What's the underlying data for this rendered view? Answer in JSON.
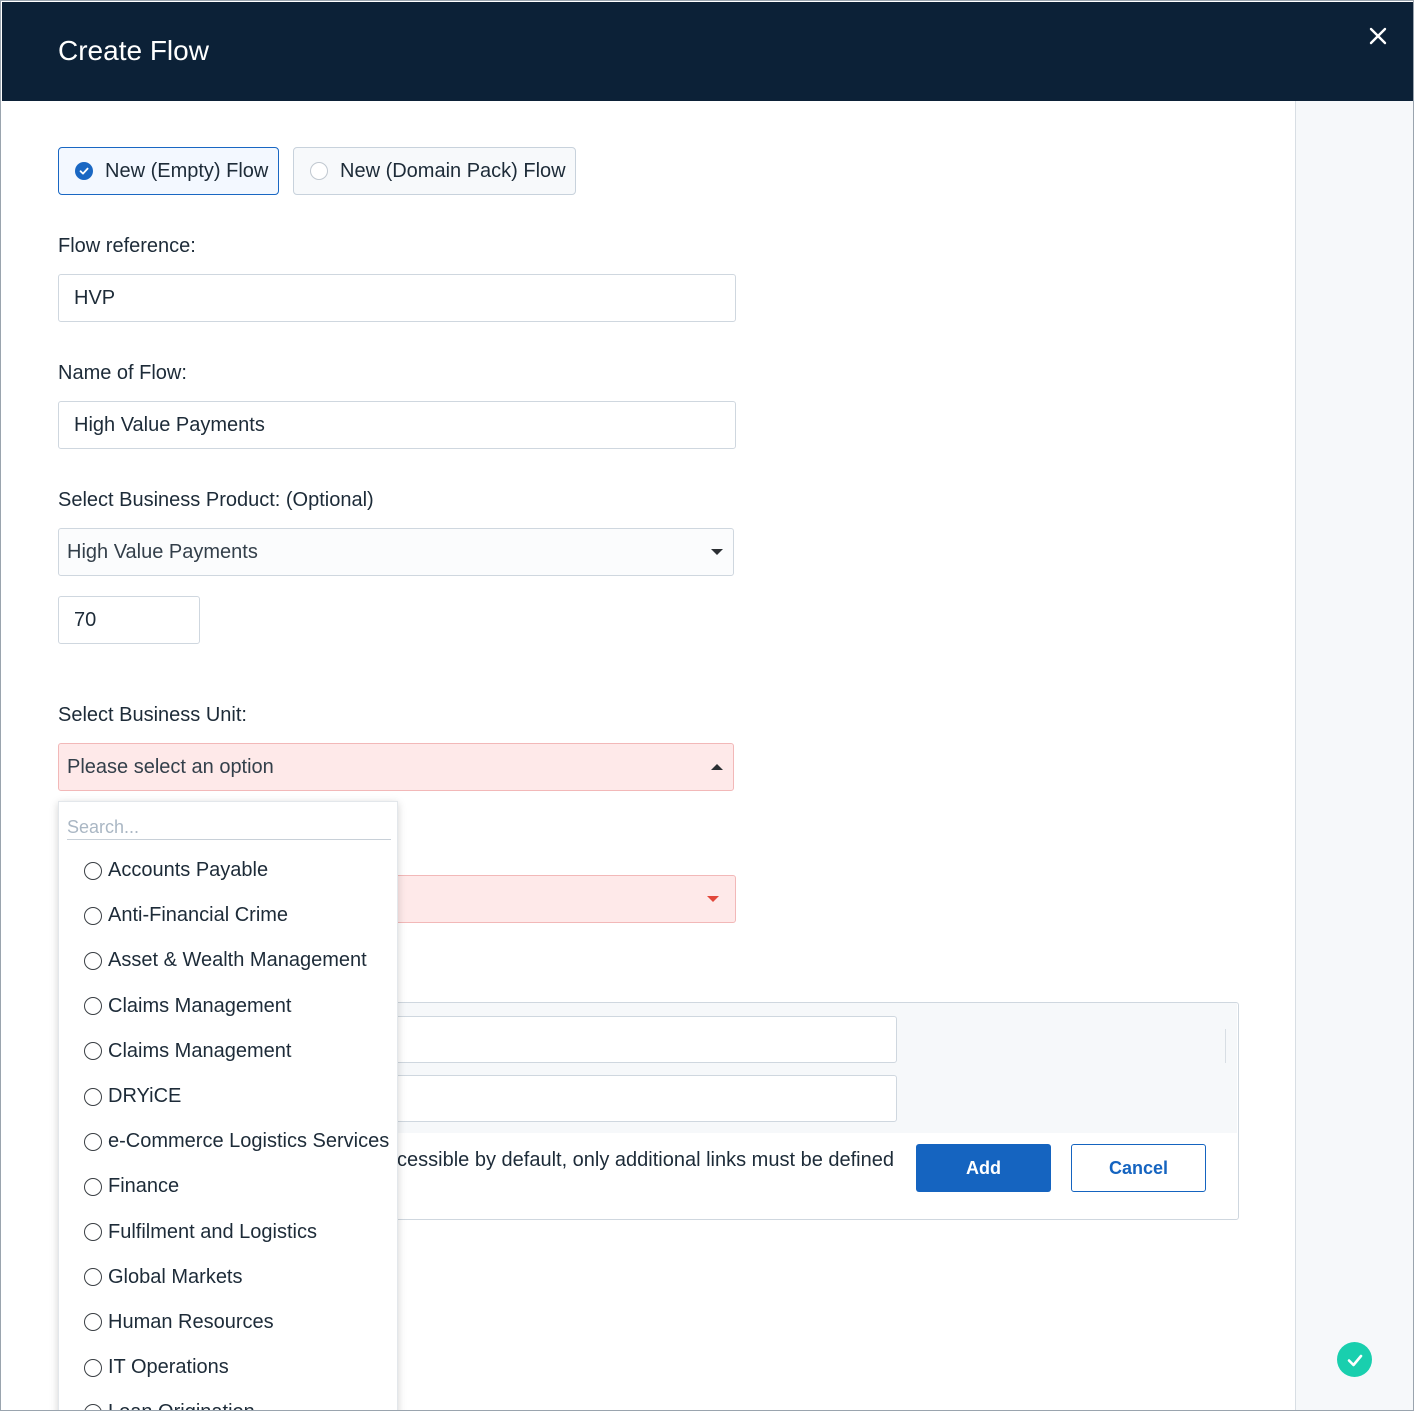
{
  "header": {
    "title": "Create Flow",
    "close_icon": "close-icon"
  },
  "flow_type": {
    "options": [
      {
        "label": "New (Empty) Flow",
        "selected": true
      },
      {
        "label": "New (Domain Pack) Flow",
        "selected": false
      }
    ]
  },
  "form": {
    "flow_reference": {
      "label": "Flow reference:",
      "value": "HVP"
    },
    "flow_name": {
      "label": "Name of Flow:",
      "value": "High Value Payments"
    },
    "business_product": {
      "label": "Select Business Product: (Optional)",
      "value": "High Value Payments",
      "extra_value": "70"
    },
    "business_unit": {
      "label": "Select Business Unit:",
      "placeholder": "Please select an option"
    }
  },
  "dropdown": {
    "search_placeholder": "Search...",
    "options": [
      "Accounts Payable",
      "Anti-Financial Crime",
      "Asset & Wealth Management",
      "Claims Management",
      "Claims Management",
      "DRYiCE",
      "e-Commerce Logistics Services",
      "Finance",
      "Fulfilment and Logistics",
      "Global Markets",
      "Human Resources",
      "IT Operations",
      "Loan Origination"
    ]
  },
  "links_panel": {
    "note": "ccessible by default, only additional links must be defined",
    "add_label": "Add",
    "cancel_label": "Cancel"
  },
  "colors": {
    "header_bg": "#0c2137",
    "primary": "#1564c0",
    "error_bg": "#fee9e9",
    "success": "#19cfae"
  }
}
